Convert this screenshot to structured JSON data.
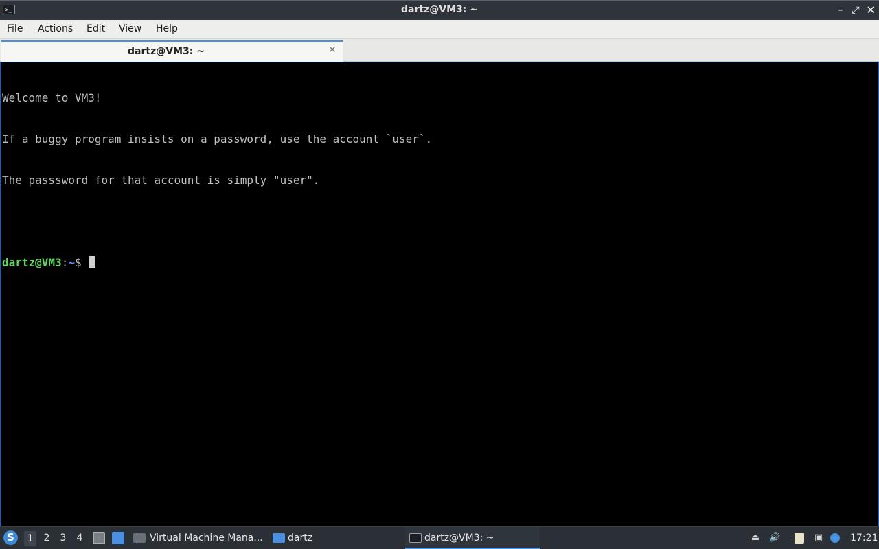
{
  "window": {
    "title": "dartz@VM3: ~",
    "app_icon": ">_",
    "controls": {
      "minimize": "–",
      "maximize": "⤢",
      "close": "✕"
    }
  },
  "menubar": {
    "items": [
      "File",
      "Actions",
      "Edit",
      "View",
      "Help"
    ]
  },
  "tabs": [
    {
      "label": "dartz@VM3: ~",
      "close": "✕"
    }
  ],
  "terminal": {
    "lines": [
      "Welcome to VM3!",
      "If a buggy program insists on a password, use the account `user`.",
      "The passsword for that account is simply \"user\"."
    ],
    "prompt": {
      "user_host": "dartz@VM3",
      "colon": ":",
      "path": "~",
      "sign": "$"
    },
    "colors": {
      "text": "#c0c0c0",
      "user": "#5fd75f",
      "path": "#6c8cff",
      "background": "#000000"
    }
  },
  "taskbar": {
    "start_icon": "start-menu-icon",
    "workspaces": [
      "1",
      "2",
      "3",
      "4"
    ],
    "active_workspace": "1",
    "tasks": [
      {
        "label": "Virtual Machine Mana...",
        "icon": "virt-manager-icon"
      },
      {
        "label": "dartz",
        "icon": "folder-icon"
      },
      {
        "label": "dartz@VM3: ~",
        "icon": "terminal-icon",
        "active": true
      }
    ],
    "tray": [
      "eject-icon",
      "volume-icon",
      "clipboard-icon",
      "network-icon",
      "notification-icon"
    ],
    "clock": "17:21"
  }
}
